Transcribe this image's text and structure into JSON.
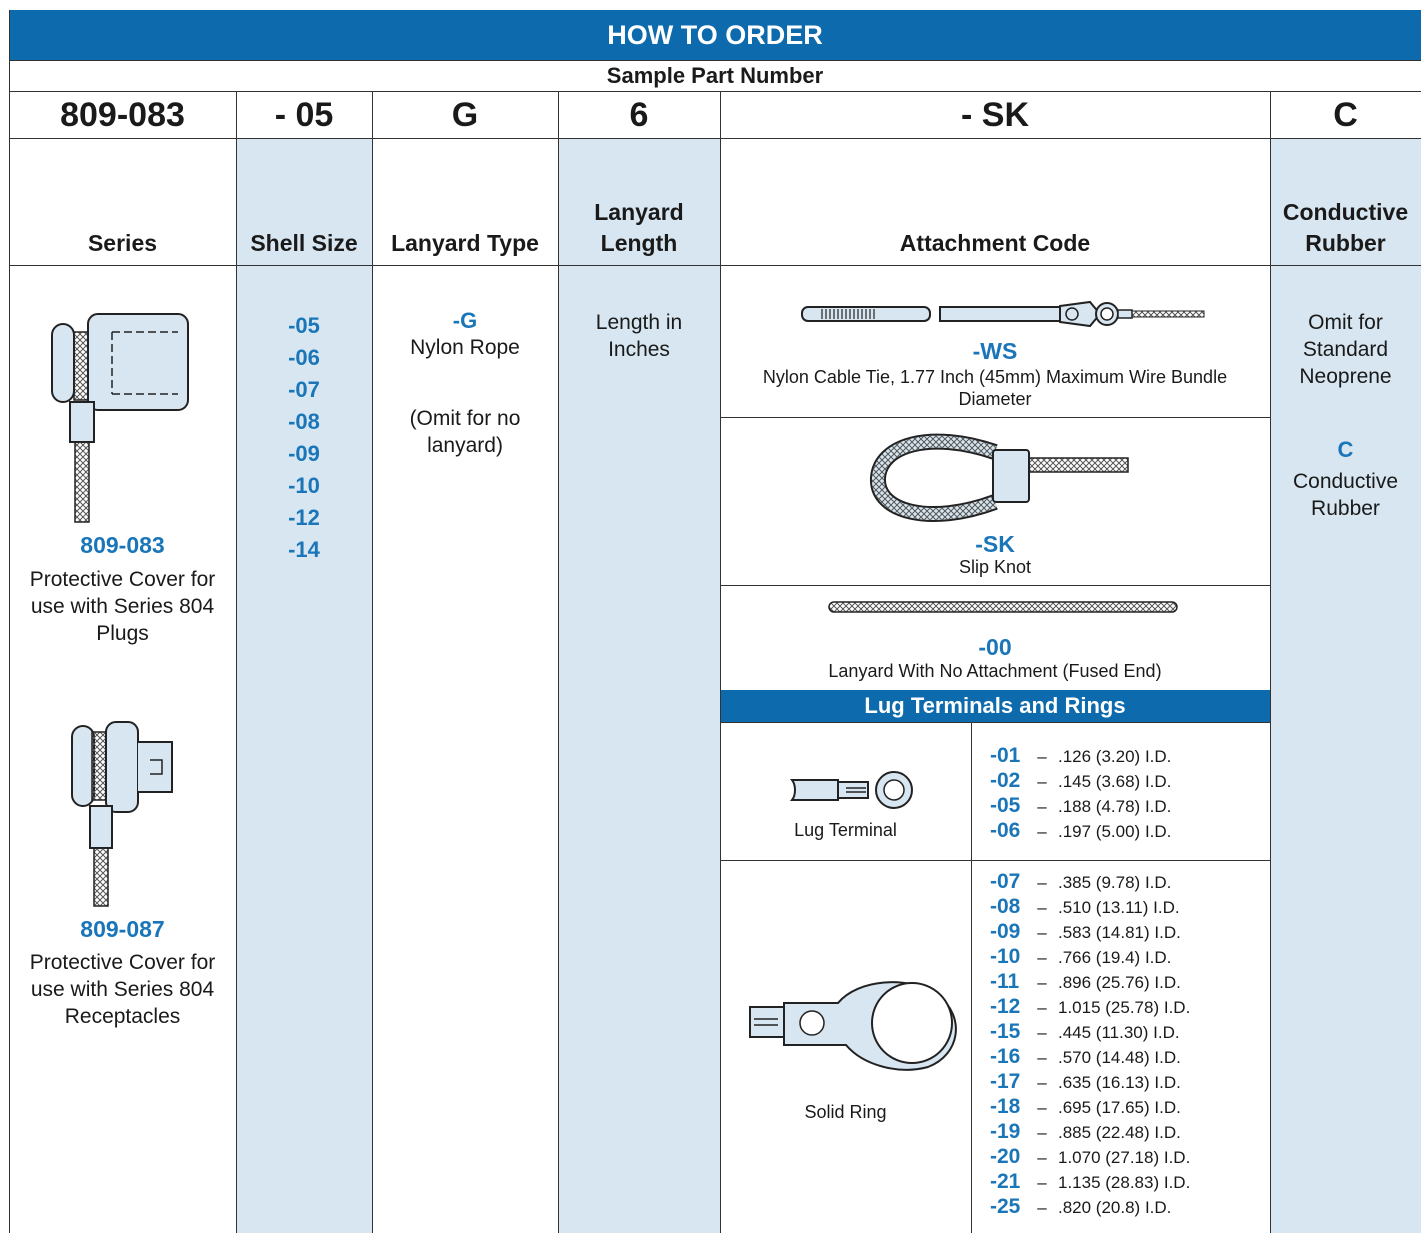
{
  "title": "HOW TO ORDER",
  "subtitle": "Sample Part Number",
  "sample_parts": [
    "809-083",
    "- 05",
    "G",
    "6",
    "- SK",
    "C"
  ],
  "headers": {
    "series": "Series",
    "shell_size": "Shell Size",
    "lanyard_type": "Lanyard Type",
    "lanyard_length": "Lanyard Length",
    "attachment_code": "Attachment Code",
    "conductive_rubber": "Conductive Rubber"
  },
  "series": [
    {
      "code": "809-083",
      "desc": "Protective Cover for use with Series 804 Plugs"
    },
    {
      "code": "809-087",
      "desc": "Protective Cover for use with Series 804 Receptacles"
    }
  ],
  "shell_sizes": [
    "-05",
    "-06",
    "-07",
    "-08",
    "-09",
    "-10",
    "-12",
    "-14"
  ],
  "lanyard_type": {
    "code": "-G",
    "name": "Nylon Rope",
    "note": "(Omit for no lanyard)"
  },
  "lanyard_length": {
    "text": "Length in Inches"
  },
  "attachments": [
    {
      "code": "-WS",
      "desc": "Nylon Cable Tie, 1.77 Inch (45mm) Maximum Wire Bundle Diameter"
    },
    {
      "code": "-SK",
      "desc": "Slip Knot"
    },
    {
      "code": "-00",
      "desc": "Lanyard With No Attachment (Fused End)"
    }
  ],
  "lug_section": {
    "title": "Lug Terminals and Rings",
    "lug_terminal": {
      "label": "Lug Terminal",
      "codes": [
        {
          "code": "-01",
          "value": ".126 (3.20) I.D."
        },
        {
          "code": "-02",
          "value": ".145 (3.68) I.D."
        },
        {
          "code": "-05",
          "value": ".188 (4.78) I.D."
        },
        {
          "code": "-06",
          "value": ".197 (5.00) I.D."
        }
      ]
    },
    "solid_ring": {
      "label": "Solid Ring",
      "codes": [
        {
          "code": "-07",
          "value": ".385 (9.78) I.D."
        },
        {
          "code": "-08",
          "value": ".510 (13.11) I.D."
        },
        {
          "code": "-09",
          "value": ".583 (14.81) I.D."
        },
        {
          "code": "-10",
          "value": ".766 (19.4) I.D."
        },
        {
          "code": "-11",
          "value": ".896 (25.76) I.D."
        },
        {
          "code": "-12",
          "value": "1.015 (25.78) I.D."
        },
        {
          "code": "-15",
          "value": ".445 (11.30) I.D."
        },
        {
          "code": "-16",
          "value": ".570 (14.48) I.D."
        },
        {
          "code": "-17",
          "value": ".635 (16.13) I.D."
        },
        {
          "code": "-18",
          "value": ".695 (17.65) I.D."
        },
        {
          "code": "-19",
          "value": ".885 (22.48) I.D."
        },
        {
          "code": "-20",
          "value": "1.070 (27.18) I.D."
        },
        {
          "code": "-21",
          "value": "1.135 (28.83) I.D."
        },
        {
          "code": "-25",
          "value": ".820 (20.8) I.D."
        }
      ]
    },
    "dash": "–"
  },
  "conductive": {
    "omit_text": "Omit for Standard Neoprene",
    "code": "C",
    "name": "Conductive Rubber"
  },
  "colors": {
    "banner": "#0c6aad",
    "band": "#d7e6f0",
    "accent": "#1a76b8"
  }
}
